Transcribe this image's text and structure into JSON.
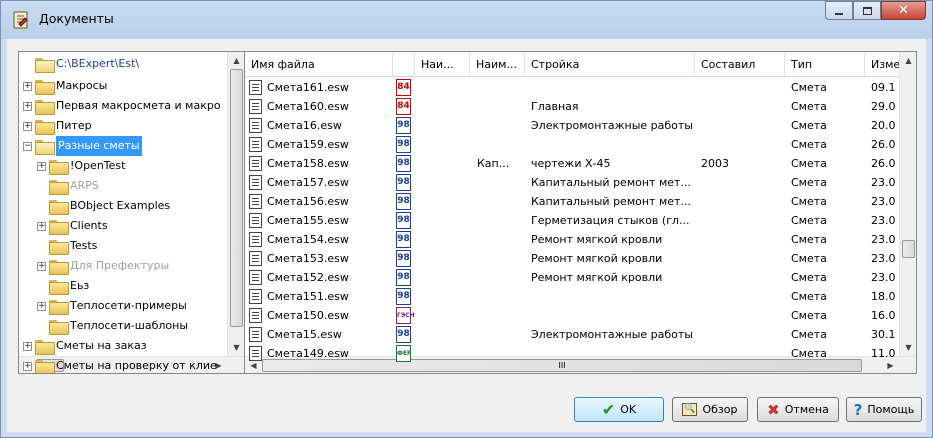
{
  "window": {
    "title": "Документы",
    "icon": "scroll-icon"
  },
  "tree": {
    "items": [
      {
        "label": "C:\\BExpert\\Est\\",
        "exp": "",
        "state": "root"
      },
      {
        "label": "Макросы",
        "exp": "+"
      },
      {
        "label": "Первая макросмета и макро",
        "exp": "+"
      },
      {
        "label": "Питер",
        "exp": "+"
      },
      {
        "label": "Разные сметы",
        "exp": "−",
        "selected": true
      },
      {
        "label": "!OpenTest",
        "exp": "+"
      },
      {
        "label": "ARPS",
        "exp": "",
        "grey": true
      },
      {
        "label": "BObject Examples",
        "exp": ""
      },
      {
        "label": "Clients",
        "exp": "+"
      },
      {
        "label": "Tests",
        "exp": ""
      },
      {
        "label": "Для Префектуры",
        "exp": "+",
        "grey": true
      },
      {
        "label": "Еьз",
        "exp": ""
      },
      {
        "label": "Теплосети-примеры",
        "exp": "+"
      },
      {
        "label": "Теплосети-шаблоны",
        "exp": ""
      },
      {
        "label": "Сметы на заказ",
        "exp": "+"
      },
      {
        "label": "Сметы на проверку от клие",
        "exp": "+"
      }
    ],
    "hscroll_label": "III"
  },
  "list": {
    "columns": [
      "Имя файла",
      "",
      "Наи...",
      "Наим...",
      "Стройка",
      "Составил",
      "Тип",
      "Изме"
    ],
    "rows": [
      {
        "name": "Смета161.esw",
        "badge": "84",
        "badge_color": "#cc0000",
        "n1": "",
        "n2": "",
        "site": "",
        "author": "",
        "type": "Смета",
        "mod": "09.1"
      },
      {
        "name": "Смета160.esw",
        "badge": "84",
        "badge_color": "#cc0000",
        "n1": "",
        "n2": "",
        "site": "Главная",
        "author": "",
        "type": "Смета",
        "mod": "29.0"
      },
      {
        "name": "Смета16.esw",
        "badge": "98",
        "badge_color": "#1c3f94",
        "n1": "",
        "n2": "",
        "site": "Электромонтажные работы",
        "author": "",
        "type": "Смета",
        "mod": "20.0"
      },
      {
        "name": "Смета159.esw",
        "badge": "98",
        "badge_color": "#1c3f94",
        "n1": "",
        "n2": "",
        "site": "",
        "author": "",
        "type": "Смета",
        "mod": "26.0"
      },
      {
        "name": "Смета158.esw",
        "badge": "98",
        "badge_color": "#1c3f94",
        "n1": "",
        "n2": "Кап...",
        "site": "чертежи Х-45",
        "author": "2003",
        "type": "Смета",
        "mod": "26.0"
      },
      {
        "name": "Смета157.esw",
        "badge": "98",
        "badge_color": "#1c3f94",
        "n1": "",
        "n2": "",
        "site": "Капитальный ремонт мет...",
        "author": "",
        "type": "Смета",
        "mod": "23.0"
      },
      {
        "name": "Смета156.esw",
        "badge": "98",
        "badge_color": "#1c3f94",
        "n1": "",
        "n2": "",
        "site": "Капитальный ремонт мет...",
        "author": "",
        "type": "Смета",
        "mod": "23.0"
      },
      {
        "name": "Смета155.esw",
        "badge": "98",
        "badge_color": "#1c3f94",
        "n1": "",
        "n2": "",
        "site": "Герметизация стыков (гл...",
        "author": "",
        "type": "Смета",
        "mod": "23.0"
      },
      {
        "name": "Смета154.esw",
        "badge": "98",
        "badge_color": "#1c3f94",
        "n1": "",
        "n2": "",
        "site": "Ремонт мягкой кровли",
        "author": "",
        "type": "Смета",
        "mod": "23.0"
      },
      {
        "name": "Смета153.esw",
        "badge": "98",
        "badge_color": "#1c3f94",
        "n1": "",
        "n2": "",
        "site": "Ремонт мягкой кровли",
        "author": "",
        "type": "Смета",
        "mod": "23.0"
      },
      {
        "name": "Смета152.esw",
        "badge": "98",
        "badge_color": "#1c3f94",
        "n1": "",
        "n2": "",
        "site": "Ремонт мягкой кровли",
        "author": "",
        "type": "Смета",
        "mod": "23.0"
      },
      {
        "name": "Смета151.esw",
        "badge": "98",
        "badge_color": "#1c3f94",
        "n1": "",
        "n2": "",
        "site": "",
        "author": "",
        "type": "Смета",
        "mod": "18.0"
      },
      {
        "name": "Смета150.esw",
        "badge": "ГЭСН",
        "badge_color": "#8a1c6e",
        "n1": "",
        "n2": "",
        "site": "",
        "author": "",
        "type": "Смета",
        "mod": "16.0"
      },
      {
        "name": "Смета15.esw",
        "badge": "98",
        "badge_color": "#1c3f94",
        "n1": "",
        "n2": "",
        "site": "Электромонтажные работы",
        "author": "",
        "type": "Смета",
        "mod": "30.1"
      },
      {
        "name": "Смета149.esw",
        "badge": "ФЕР",
        "badge_color": "#127a2e",
        "n1": "",
        "n2": "",
        "site": "",
        "author": "",
        "type": "Смета",
        "mod": "11.0"
      }
    ],
    "hscroll_label": "III"
  },
  "buttons": {
    "ok": "OK",
    "browse": "Обзор",
    "cancel": "Отмена",
    "help": "Помощь"
  }
}
